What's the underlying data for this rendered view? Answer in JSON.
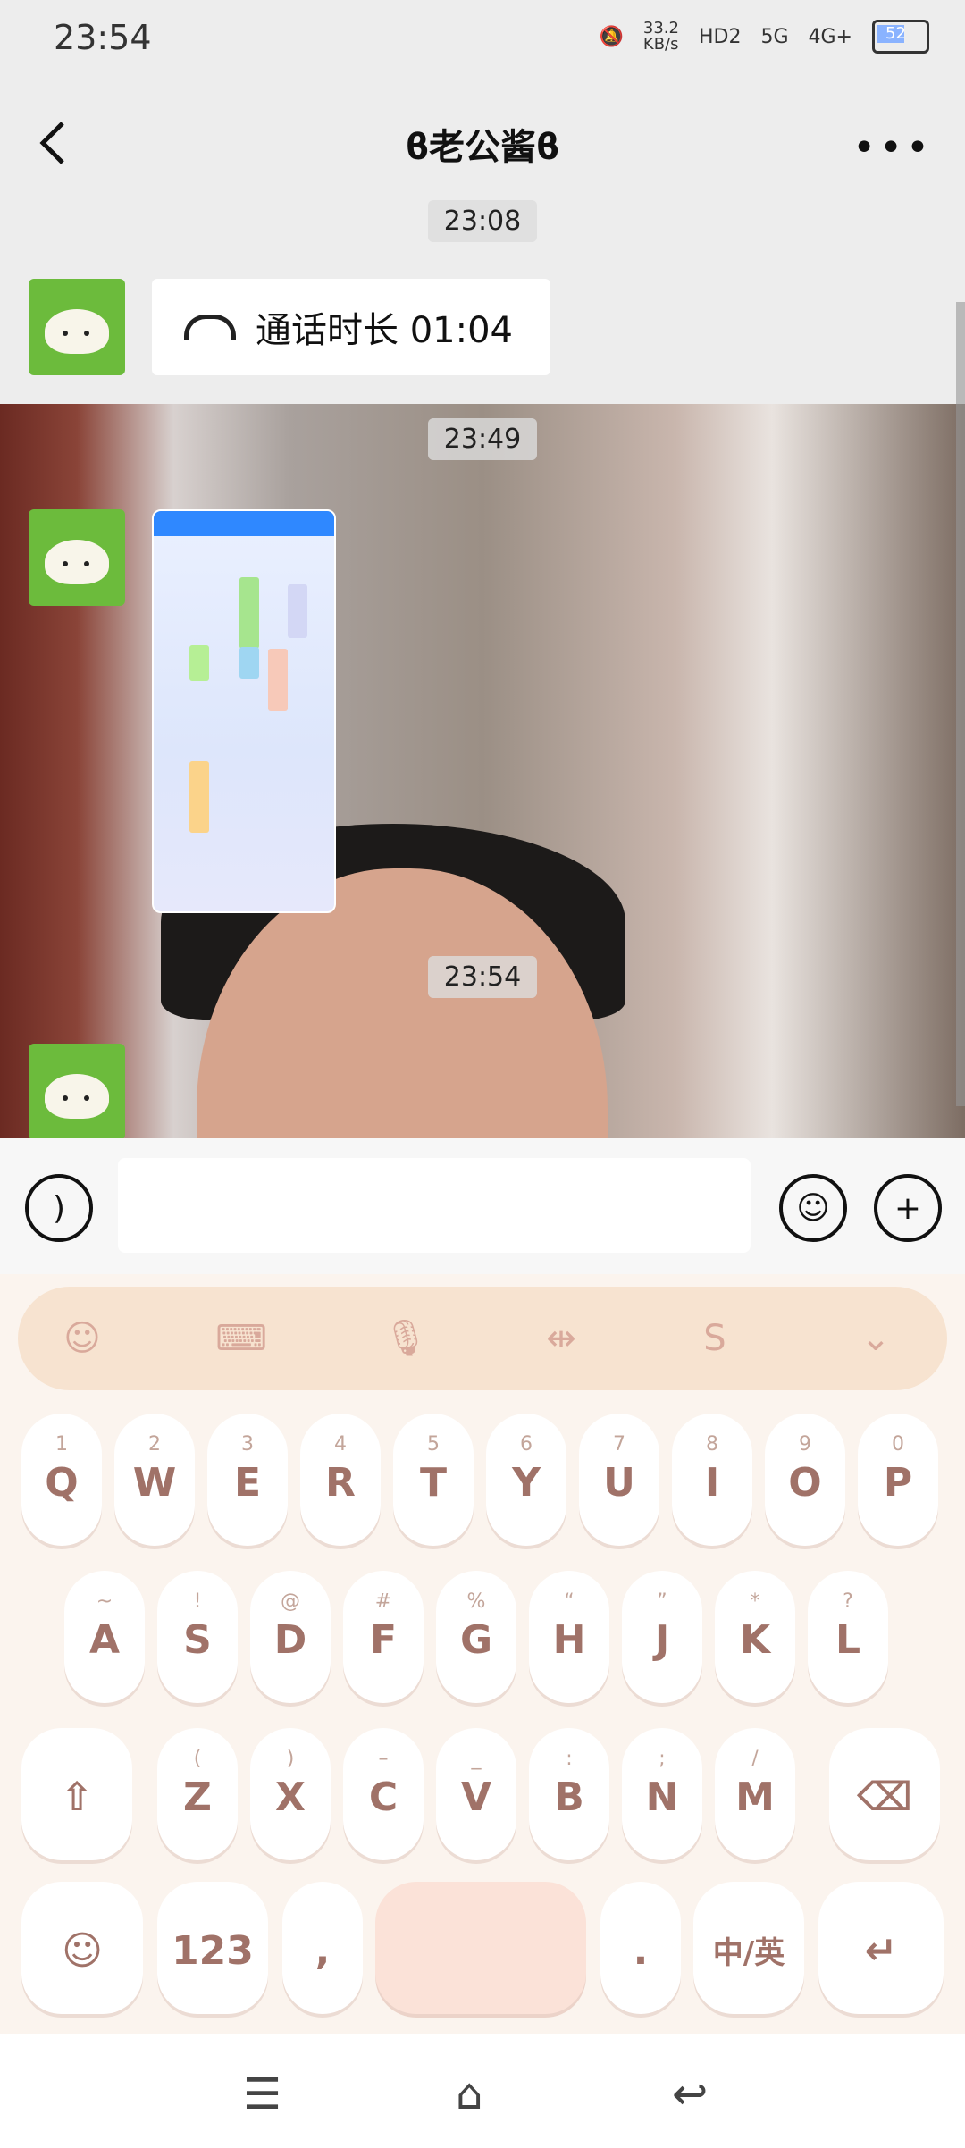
{
  "status": {
    "time": "23:54",
    "net_speed": "33.2\nKB/s",
    "net": [
      "HD2",
      "5G",
      "4G+"
    ],
    "battery": "52"
  },
  "header": {
    "title": "ϐ老公酱ϐ"
  },
  "chat": {
    "timestamps": [
      "23:08",
      "23:49",
      "23:54"
    ],
    "call_label": "通话时长 01:04"
  },
  "keyboard": {
    "row1": [
      {
        "k": "Q",
        "h": "1"
      },
      {
        "k": "W",
        "h": "2"
      },
      {
        "k": "E",
        "h": "3"
      },
      {
        "k": "R",
        "h": "4"
      },
      {
        "k": "T",
        "h": "5"
      },
      {
        "k": "Y",
        "h": "6"
      },
      {
        "k": "U",
        "h": "7"
      },
      {
        "k": "I",
        "h": "8"
      },
      {
        "k": "O",
        "h": "9"
      },
      {
        "k": "P",
        "h": "0"
      }
    ],
    "row2": [
      {
        "k": "A",
        "h": "~"
      },
      {
        "k": "S",
        "h": "!"
      },
      {
        "k": "D",
        "h": "@"
      },
      {
        "k": "F",
        "h": "#"
      },
      {
        "k": "G",
        "h": "%"
      },
      {
        "k": "H",
        "h": "“"
      },
      {
        "k": "J",
        "h": "”"
      },
      {
        "k": "K",
        "h": "*"
      },
      {
        "k": "L",
        "h": "?"
      }
    ],
    "row3": [
      {
        "k": "Z",
        "h": "("
      },
      {
        "k": "X",
        "h": ")"
      },
      {
        "k": "C",
        "h": "–"
      },
      {
        "k": "V",
        "h": "_"
      },
      {
        "k": "B",
        "h": ":"
      },
      {
        "k": "N",
        "h": ";"
      },
      {
        "k": "M",
        "h": "/"
      }
    ],
    "num_key": "123",
    "lang_key": "中/英"
  }
}
